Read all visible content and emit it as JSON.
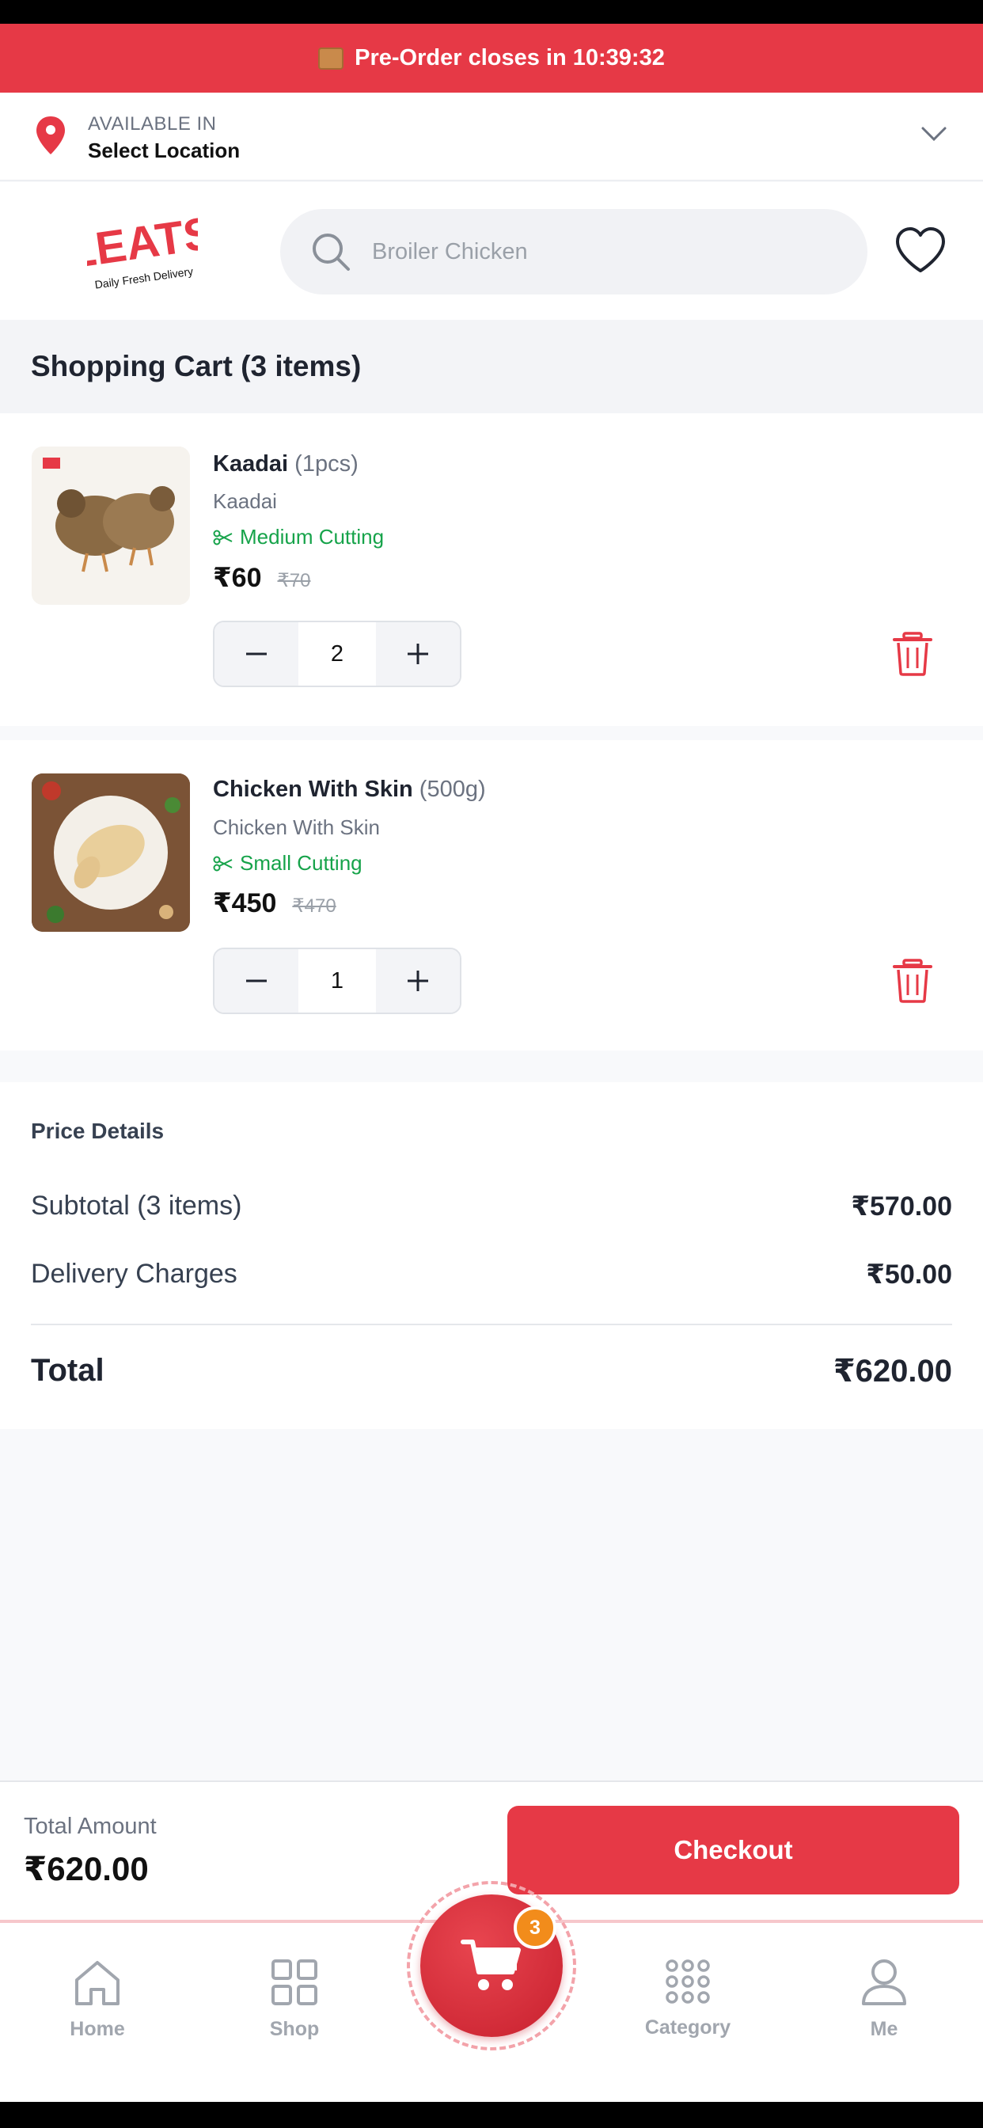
{
  "banner": {
    "icon": "package-icon",
    "text": "Pre-Order closes in 10:39:32"
  },
  "location": {
    "label": "AVAILABLE IN",
    "value": "Select Location"
  },
  "header": {
    "logo_text": "LEATS",
    "logo_tagline": "Daily Fresh Delivery",
    "search_placeholder": "Broiler Chicken"
  },
  "cart": {
    "title": "Shopping Cart (3 items)",
    "items": [
      {
        "name": "Kaadai",
        "qty": "(1pcs)",
        "subtitle": "Kaadai",
        "cutting": "Medium Cutting",
        "price": "₹60",
        "mrp": "₹70",
        "quantity": "2"
      },
      {
        "name": "Chicken With Skin",
        "qty": "(500g)",
        "subtitle": "Chicken With Skin",
        "cutting": "Small Cutting",
        "price": "₹450",
        "mrp": "₹470",
        "quantity": "1"
      }
    ]
  },
  "price_details": {
    "title": "Price Details",
    "subtotal_label": "Subtotal (3 items)",
    "subtotal_value": "₹570.00",
    "delivery_label": "Delivery Charges",
    "delivery_value": "₹50.00",
    "total_label": "Total",
    "total_value": "₹620.00"
  },
  "checkout": {
    "total_label": "Total Amount",
    "total_value": "₹620.00",
    "button": "Checkout"
  },
  "nav": {
    "home": "Home",
    "shop": "Shop",
    "category": "Category",
    "me": "Me",
    "cart_count": "3"
  },
  "colors": {
    "brand": "#e63946",
    "success": "#16a34a",
    "badge": "#f28c1b"
  }
}
